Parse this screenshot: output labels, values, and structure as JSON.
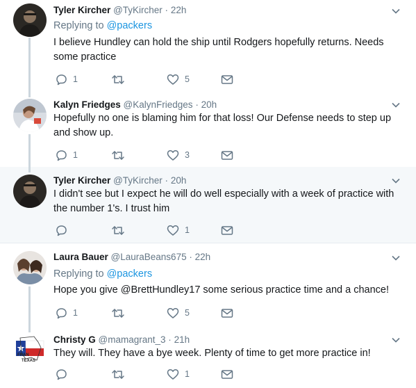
{
  "colors": {
    "accent": "#1b95e0",
    "muted": "#657786",
    "text": "#14171a",
    "highlight_bg": "#f5f8fa",
    "thread_line": "#ccd6dd"
  },
  "tweets": [
    {
      "name": "Tyler Kircher",
      "handle": "@TyKircher",
      "sep": "·",
      "time": "22h",
      "reply_prefix": "Replying to",
      "reply_to": "@packers",
      "text": "I believe Hundley can hold the ship until Rodgers hopefully returns. Needs some practice",
      "replies": "1",
      "retweets": "",
      "likes": "5"
    },
    {
      "name": "Kalyn Friedges",
      "handle": "@KalynFriedges",
      "sep": "·",
      "time": "20h",
      "text": "Hopefully no one is blaming him for that loss! Our Defense needs to step up and show up.",
      "replies": "1",
      "retweets": "",
      "likes": "3"
    },
    {
      "name": "Tyler Kircher",
      "handle": "@TyKircher",
      "sep": "·",
      "time": "20h",
      "text": "I didn't see but I expect he will do well especially with a week of practice with the number 1's. I trust him",
      "replies": "",
      "retweets": "",
      "likes": "1"
    },
    {
      "name": "Laura Bauer",
      "handle": "@LauraBeans675",
      "sep": "·",
      "time": "22h",
      "reply_prefix": "Replying to",
      "reply_to": "@packers",
      "text": "Hope you give @BrettHundley17 some serious practice time and a chance!",
      "replies": "1",
      "retweets": "",
      "likes": "5"
    },
    {
      "name": "Christy G",
      "handle": "@mamagrant_3",
      "sep": "·",
      "time": "21h",
      "text": "They will. They have a bye week. Plenty of time to get more practice in!",
      "replies": "",
      "retweets": "",
      "likes": "1"
    }
  ]
}
